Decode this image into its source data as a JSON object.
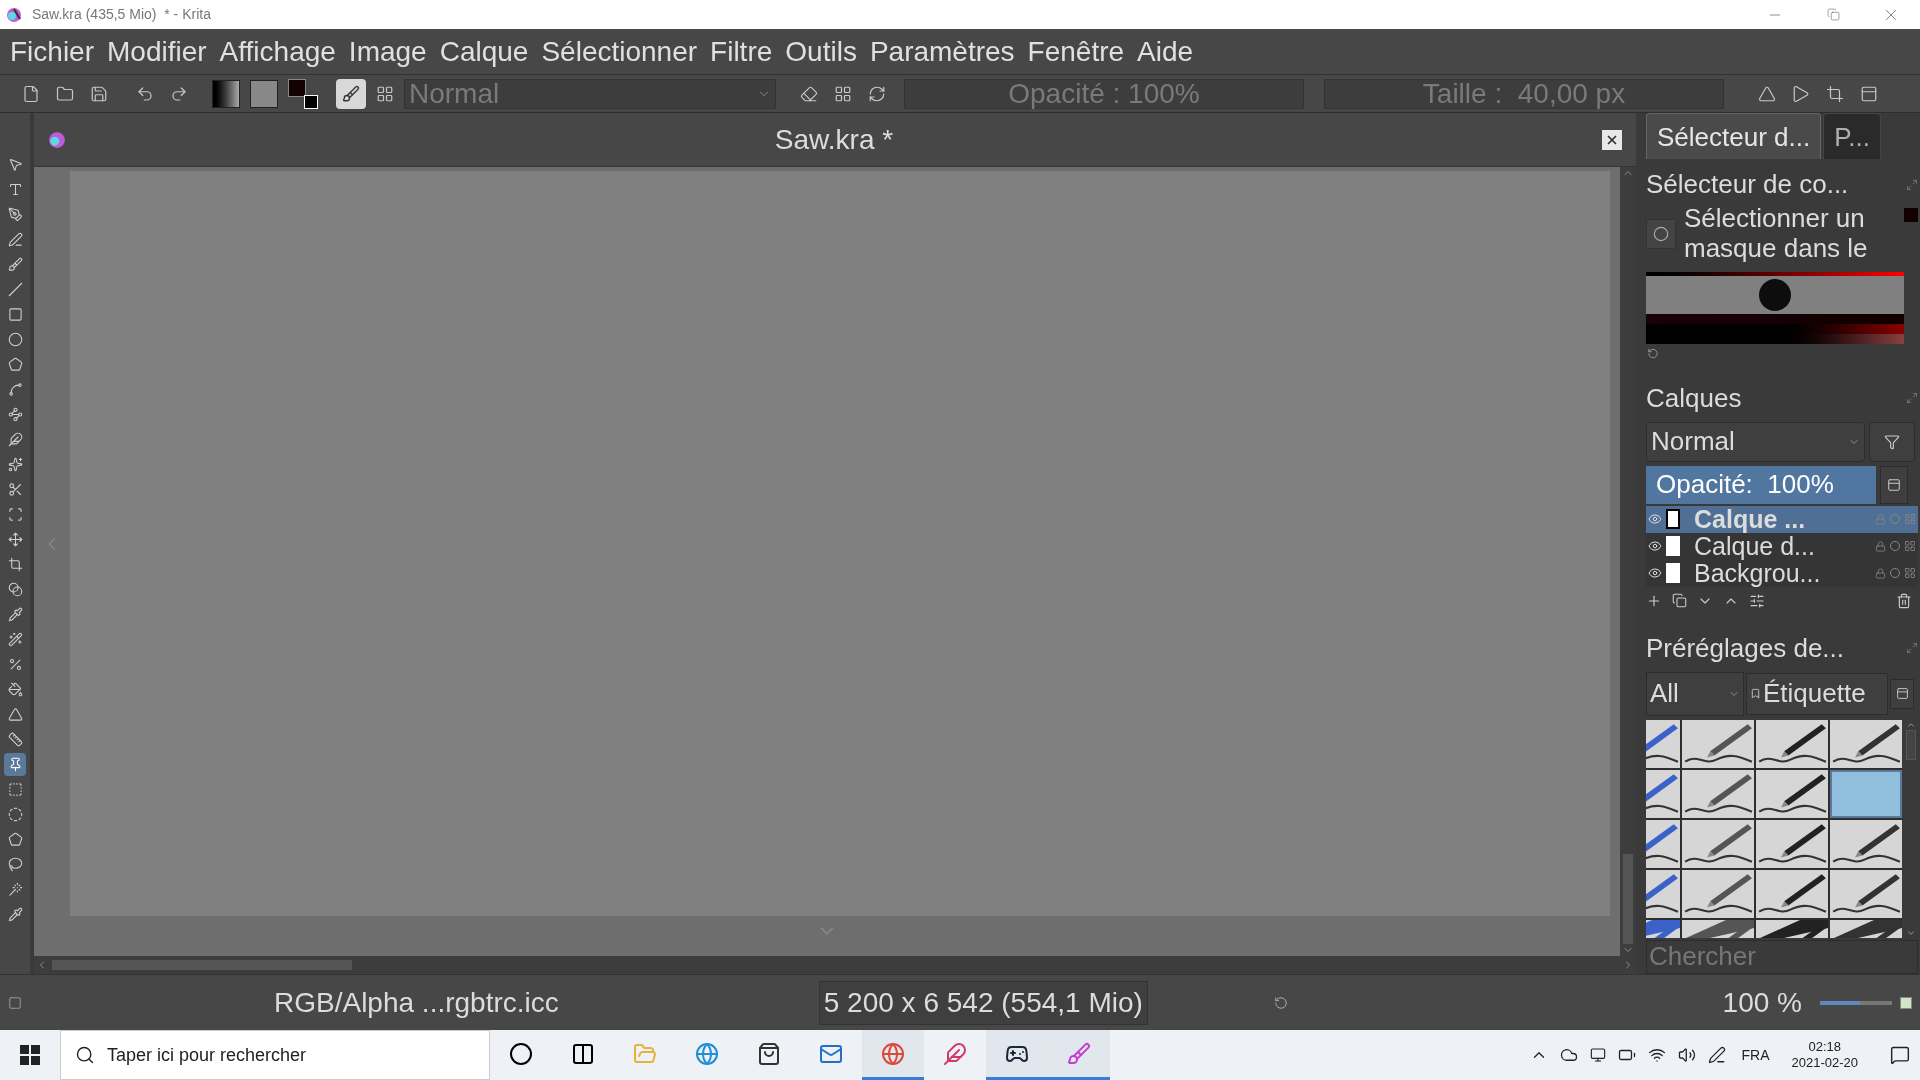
{
  "window": {
    "title": "Saw.kra (435,5 Mio)  * - Krita"
  },
  "menu": [
    "Fichier",
    "Modifier",
    "Affichage",
    "Image",
    "Calque",
    "Sélectionner",
    "Filtre",
    "Outils",
    "Paramètres",
    "Fenêtre",
    "Aide"
  ],
  "toolbar": {
    "blend_mode": "Normal",
    "opacity": "Opacité : 100%",
    "size": "Taille :  40,00 px"
  },
  "tools": [
    {
      "selected": false
    },
    {
      "selected": false
    },
    {
      "selected": false
    },
    {
      "selected": false
    },
    {
      "selected": false
    },
    {
      "selected": false
    },
    {
      "selected": false
    },
    {
      "selected": false
    },
    {
      "selected": false
    },
    {
      "selected": false
    },
    {
      "selected": false
    },
    {
      "selected": false
    },
    {
      "selected": false
    },
    {
      "selected": false
    },
    {
      "selected": false
    },
    {
      "selected": false
    },
    {
      "selected": false
    },
    {
      "selected": false
    },
    {
      "selected": false
    },
    {
      "selected": false
    },
    {
      "selected": false
    },
    {
      "selected": false
    },
    {
      "selected": false
    },
    {
      "selected": false
    },
    {
      "selected": true
    },
    {
      "selected": false
    },
    {
      "selected": false
    },
    {
      "selected": false
    },
    {
      "selected": false
    },
    {
      "selected": false
    },
    {
      "selected": false
    }
  ],
  "document": {
    "tab_title": "Saw.kra *"
  },
  "docker_tabs": [
    {
      "label": "Sélecteur d...",
      "selected": true
    },
    {
      "label": "P...",
      "selected": false
    }
  ],
  "color_selector": {
    "title": "Sélecteur de co...",
    "hint": "Sélectionner un masque dans le"
  },
  "layers": {
    "title": "Calques",
    "blend_mode": "Normal",
    "opacity": {
      "text": "Opacité:  100%",
      "level": 1
    },
    "items": [
      {
        "name": "Calque ...",
        "selected": true
      },
      {
        "name": "Calque d...",
        "selected": false
      },
      {
        "name": "Backgrou...",
        "selected": false
      }
    ]
  },
  "presets": {
    "title": "Préréglages de...",
    "filter": "All",
    "tag": "Étiquette",
    "search_placeholder": "Chercher",
    "items": [
      {
        "selected": false
      },
      {
        "selected": false
      },
      {
        "selected": false
      },
      {
        "selected": false
      },
      {
        "selected": false
      },
      {
        "selected": false
      },
      {
        "selected": false
      },
      {
        "selected": true
      },
      {
        "selected": false
      },
      {
        "selected": false
      },
      {
        "selected": false
      },
      {
        "selected": false
      },
      {
        "selected": false
      },
      {
        "selected": false
      },
      {
        "selected": false
      },
      {
        "selected": false
      },
      {
        "selected": false
      },
      {
        "selected": false
      },
      {
        "selected": false
      },
      {
        "selected": false
      }
    ]
  },
  "status_bar": {
    "color_profile": "RGB/Alpha ...rgbtrc.icc",
    "dimensions": "5 200 x 6 542 (554,1 Mio)",
    "zoom": "100 %",
    "zoom_level": {
      "level": 0.55
    }
  },
  "taskbar": {
    "search_placeholder": "Taper ici pour rechercher",
    "apps": [
      {
        "active": false
      },
      {
        "active": false
      },
      {
        "active": false
      },
      {
        "active": false
      },
      {
        "active": false
      },
      {
        "active": false
      },
      {
        "active": true
      },
      {
        "active": false
      },
      {
        "active": true
      },
      {
        "active": true
      }
    ],
    "language": "FRA",
    "time": "02:18",
    "date": "2021-02-20"
  }
}
